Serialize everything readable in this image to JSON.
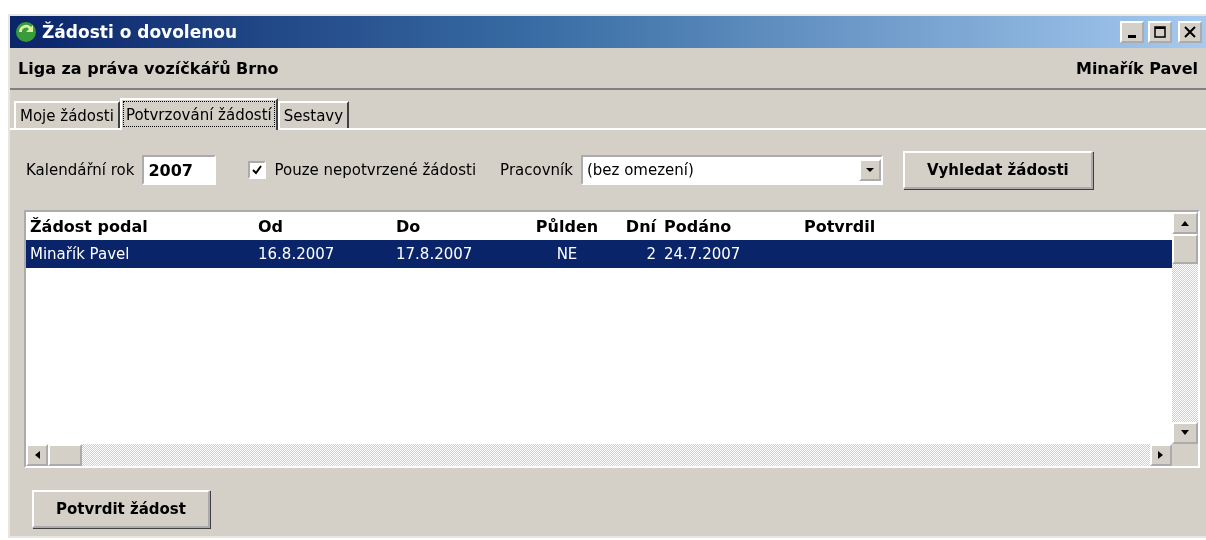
{
  "window": {
    "title": "Žádosti o dovolenou"
  },
  "header": {
    "organization": "Liga za práva vozíčkářů Brno",
    "user": "Minařík Pavel"
  },
  "tabs": [
    {
      "label": "Moje žádosti",
      "selected": false
    },
    {
      "label": "Potvrzování žádostí",
      "selected": true
    },
    {
      "label": "Sestavy",
      "selected": false
    }
  ],
  "filters": {
    "year_label": "Kalendářní rok",
    "year": "2007",
    "unconfirmed_label": "Pouze nepotvrzené žádosti",
    "unconfirmed_checked": true,
    "employee_label": "Pracovník",
    "employee": "(bez omezení)",
    "search_button": "Vyhledat žádosti"
  },
  "table": {
    "columns": [
      "Žádost podal",
      "Od",
      "Do",
      "Půlden",
      "Dní",
      "Podáno",
      "Potvrdil"
    ],
    "rows": [
      {
        "cells": [
          "Minařík Pavel",
          "16.8.2007",
          "17.8.2007",
          "NE",
          "2",
          "24.7.2007",
          ""
        ],
        "selected": true
      }
    ]
  },
  "confirm_button": "Potvrdit žádost"
}
